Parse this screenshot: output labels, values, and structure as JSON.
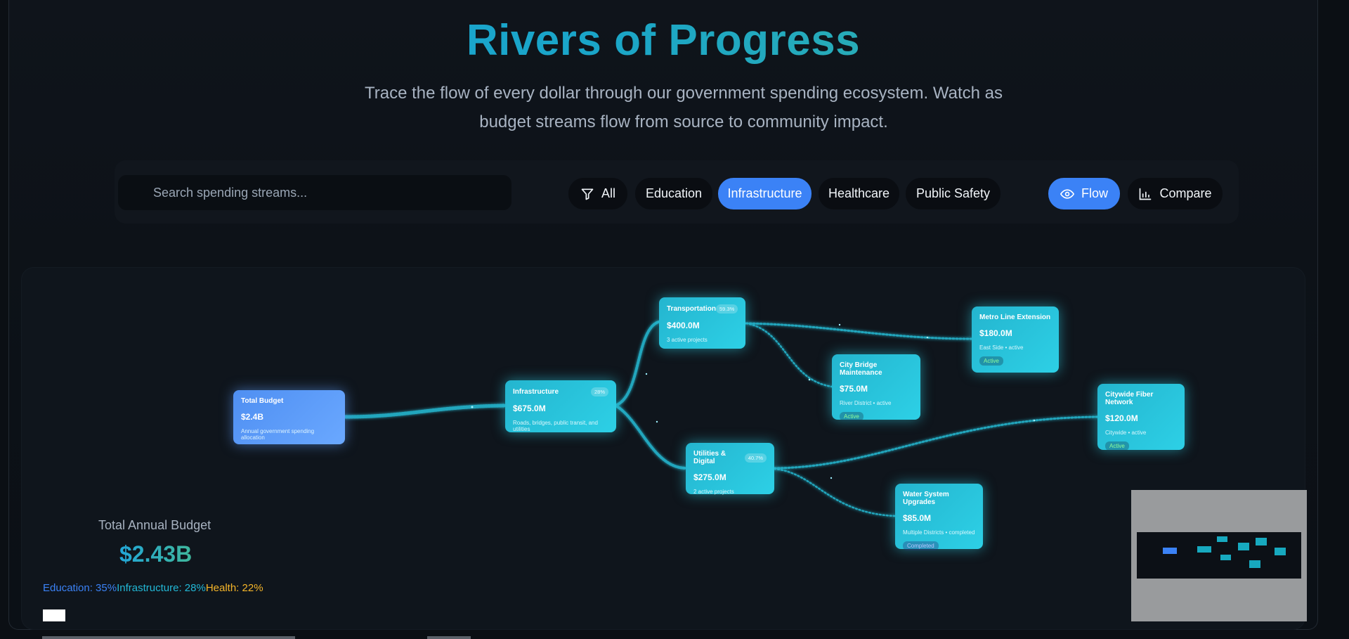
{
  "header": {
    "title": "Rivers of Progress",
    "subtitle": "Trace the flow of every dollar through our government spending ecosystem. Watch as budget streams flow from source to community impact."
  },
  "toolbar": {
    "search_placeholder": "Search spending streams...",
    "filters": [
      {
        "label": "All",
        "icon": "filter-icon",
        "active": false
      },
      {
        "label": "Education",
        "active": false
      },
      {
        "label": "Infrastructure",
        "active": true
      },
      {
        "label": "Healthcare",
        "active": false
      },
      {
        "label": "Public Safety",
        "active": false
      }
    ],
    "views": [
      {
        "label": "Flow",
        "icon": "eye-icon",
        "active": true
      },
      {
        "label": "Compare",
        "icon": "bar-chart-icon",
        "active": false
      }
    ]
  },
  "nodes": [
    {
      "id": "total",
      "name": "Total Budget",
      "amount": "$2.4B",
      "desc": "Annual government spending allocation"
    },
    {
      "id": "infra",
      "name": "Infrastructure",
      "pct": "28%",
      "amount": "$675.0M",
      "desc": "Roads, bridges, public transit, and utilities"
    },
    {
      "id": "transport",
      "name": "Transportation",
      "pct": "59.3%",
      "amount": "$400.0M",
      "desc": "3 active projects"
    },
    {
      "id": "utilities",
      "name": "Utilities & Digital",
      "pct": "40.7%",
      "amount": "$275.0M",
      "desc": "2 active projects"
    },
    {
      "id": "bridge",
      "name": "City Bridge Maintenance",
      "amount": "$75.0M",
      "desc": "River District • active",
      "status": "Active"
    },
    {
      "id": "metro",
      "name": "Metro Line Extension",
      "amount": "$180.0M",
      "desc": "East Side • active",
      "status": "Active"
    },
    {
      "id": "fiber",
      "name": "Citywide Fiber Network",
      "amount": "$120.0M",
      "desc": "Citywide • active",
      "status": "Active"
    },
    {
      "id": "water",
      "name": "Water System Upgrades",
      "amount": "$85.0M",
      "desc": "Multiple Districts • completed",
      "status": "Completed"
    }
  ],
  "stats": {
    "title": "Total Annual Budget",
    "value": "$2.43B",
    "legend": [
      {
        "text": "Education: 35%",
        "color": "#3b82f6"
      },
      {
        "text": "Infrastructure: 28%",
        "color": "#22b8d6"
      },
      {
        "text": "Health: 22%",
        "color": "#f5b529"
      }
    ]
  },
  "colors": {
    "accent": "#3b82f6",
    "node_cyan": "#2dd0e6",
    "flow": "#21a6bd"
  }
}
